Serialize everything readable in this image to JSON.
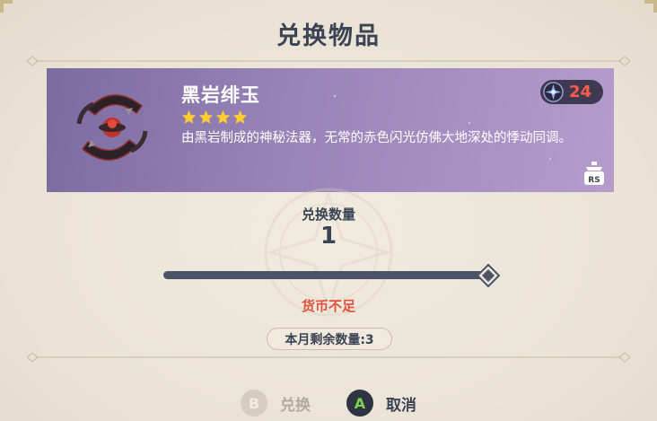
{
  "dialog": {
    "title": "兑换物品"
  },
  "item": {
    "name": "黑岩绯玉",
    "rarity": 4,
    "description": "由黑岩制成的神秘法器，无常的赤色闪光仿佛大地深处的悸动同调。",
    "icon": "blackcliff-agate-catalyst-icon"
  },
  "cost": {
    "icon": "starglitter-icon",
    "value": "24",
    "value_color": "#ff5c4a"
  },
  "rs_hint": {
    "label": "RS",
    "icon": "item-details-icon"
  },
  "quantity": {
    "label": "兑换数量",
    "value": "1",
    "slider_fraction": 1.0
  },
  "warning": {
    "text": "货币不足",
    "color": "#e0523e"
  },
  "monthly_limit": {
    "text": "本月剩余数量:3"
  },
  "buttons": {
    "exchange": {
      "key": "B",
      "label": "兑换",
      "enabled": false
    },
    "cancel": {
      "key": "A",
      "label": "取消",
      "enabled": true
    }
  },
  "colors": {
    "text_primary": "#3b4354",
    "background": "#ece5d8",
    "card_gradient_start": "#7a6ba1",
    "card_gradient_end": "#b59ccc",
    "star": "#ffcc32"
  }
}
